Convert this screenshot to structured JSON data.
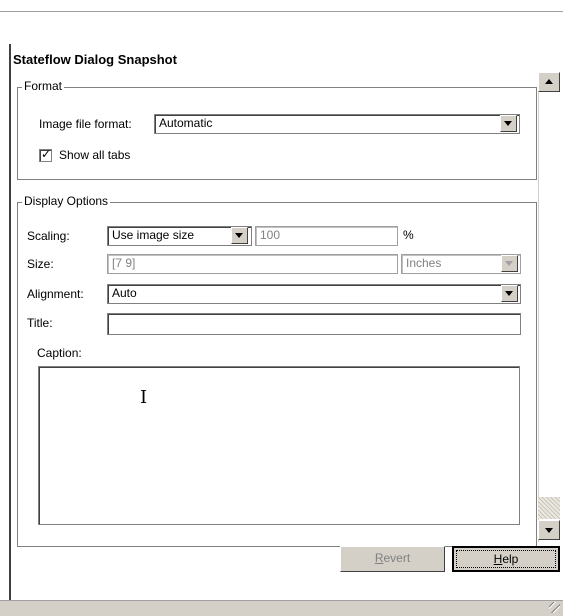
{
  "dialog": {
    "title": "Stateflow Dialog Snapshot"
  },
  "format_group": {
    "legend": "Format",
    "image_format_label": "Image file format:",
    "image_format_value": "Automatic",
    "show_all_tabs_label": "Show all tabs",
    "show_all_tabs_checked": true
  },
  "display_group": {
    "legend": "Display Options",
    "scaling_label": "Scaling:",
    "scaling_value": "Use image size",
    "scaling_percent_value": "100",
    "percent_symbol": "%",
    "size_label": "Size:",
    "size_value": "[7 9]",
    "size_units_value": "Inches",
    "alignment_label": "Alignment:",
    "alignment_value": "Auto",
    "title_label": "Title:",
    "title_value": "",
    "caption_label": "Caption:",
    "caption_value": ""
  },
  "buttons": {
    "revert_label_pre": "",
    "revert_label_ul": "R",
    "revert_label_post": "evert",
    "help_label_pre": "",
    "help_label_ul": "H",
    "help_label_post": "elp"
  },
  "icons": {
    "scroll_up": "arrow-up-icon",
    "scroll_down": "arrow-down-icon",
    "dropdown": "chevron-down-icon",
    "cursor": "text-cursor-icon",
    "resize": "resize-grip-icon"
  },
  "colors": {
    "window_bg": "#ffffff",
    "button_face": "#d4d0c8",
    "border_dark": "#808080",
    "disabled_text": "#808080"
  }
}
